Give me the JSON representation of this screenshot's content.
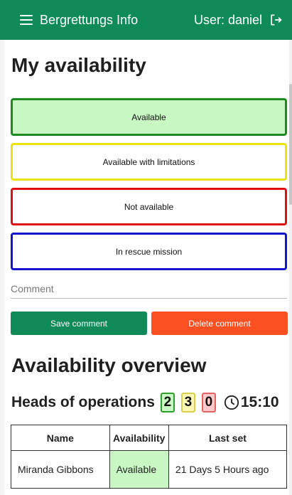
{
  "header": {
    "title": "Bergrettungs Info",
    "user_label": "User: daniel"
  },
  "availability": {
    "title": "My availability",
    "options": [
      "Available",
      "Available with limitations",
      "Not available",
      "In rescue mission"
    ],
    "comment_placeholder": "Comment",
    "save_label": "Save comment",
    "delete_label": "Delete comment"
  },
  "overview": {
    "title": "Availability overview",
    "heads_label": "Heads of operations",
    "counts": {
      "available": "2",
      "limited": "3",
      "not_available": "0"
    },
    "time": "15:10",
    "table": {
      "headers": [
        "Name",
        "Availability",
        "Last set"
      ],
      "rows": [
        {
          "name": "Miranda Gibbons",
          "availability": "Available",
          "last_set": "21 Days 5 Hours ago"
        }
      ]
    }
  },
  "colors": {
    "primary": "#0f8a58",
    "danger": "#fb5122",
    "available": "#c9f7c4",
    "available_border": "#1f8a1f",
    "limited_border": "#ece30c",
    "not_available_border": "#e01010",
    "rescue_border": "#1414cc"
  }
}
